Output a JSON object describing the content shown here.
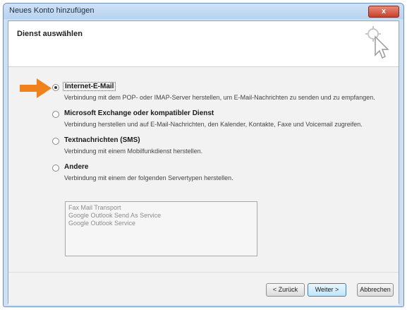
{
  "window": {
    "title": "Neues Konto hinzufügen",
    "close_label": "x"
  },
  "header": {
    "title": "Dienst auswählen"
  },
  "options": [
    {
      "label": "Internet-E-Mail",
      "description": "Verbindung mit dem POP- oder IMAP-Server herstellen, um E-Mail-Nachrichten zu senden und zu empfangen.",
      "selected": true
    },
    {
      "label": "Microsoft Exchange oder kompatibler Dienst",
      "description": "Verbindung herstellen und auf E-Mail-Nachrichten, den Kalender, Kontakte, Faxe und Voicemail zugreifen.",
      "selected": false
    },
    {
      "label": "Textnachrichten (SMS)",
      "description": "Verbindung mit einem Mobilfunkdienst herstellen.",
      "selected": false
    },
    {
      "label": "Andere",
      "description": "Verbindung mit einem der folgenden Servertypen herstellen.",
      "selected": false
    }
  ],
  "other_servers": [
    "Fax Mail Transport",
    "Google Outlook Send As Service",
    "Google Outlook Service"
  ],
  "footer": {
    "back_label": "< Zurück",
    "next_label": "Weiter >",
    "cancel_label": "Abbrechen"
  },
  "colors": {
    "arrow": "#f0821e",
    "title_bar": "#b9d2ee",
    "close_button": "#c8412c"
  }
}
